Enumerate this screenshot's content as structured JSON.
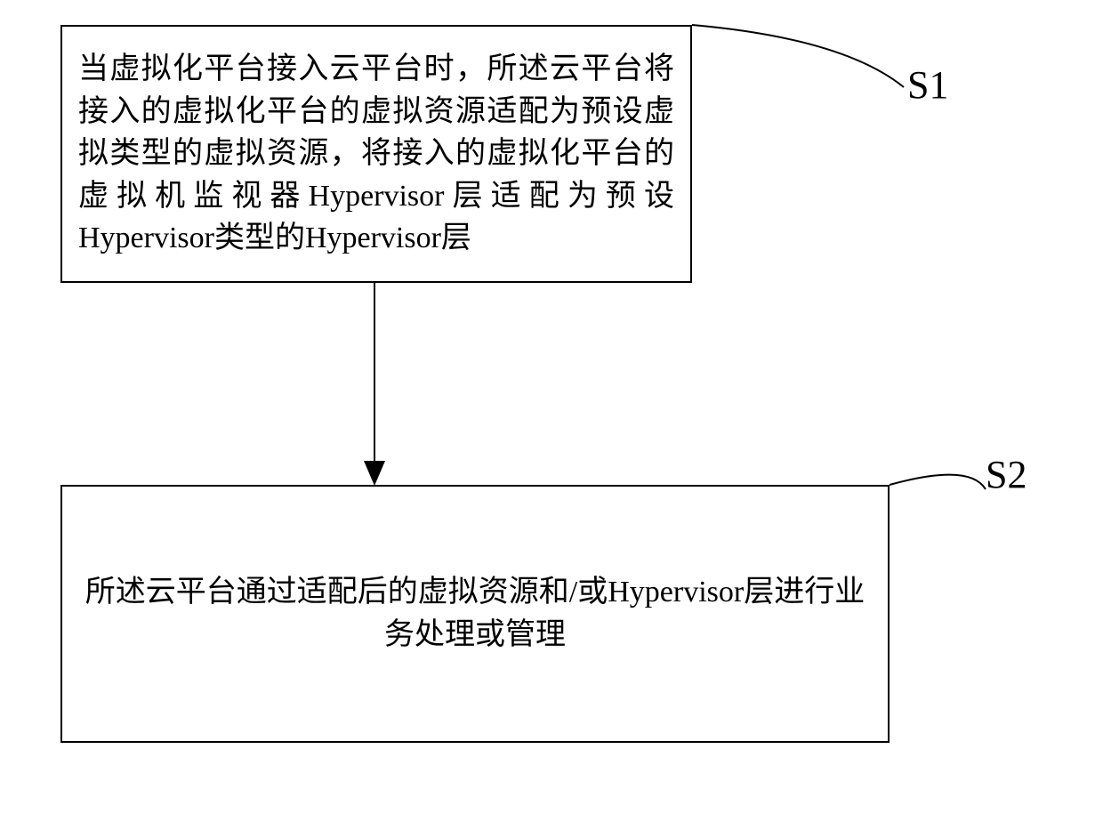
{
  "steps": {
    "s1": {
      "label": "S1",
      "text": "当虚拟化平台接入云平台时，所述云平台将接入的虚拟化平台的虚拟资源适配为预设虚拟类型的虚拟资源，将接入的虚拟化平台的虚拟机监视器Hypervisor层适配为预设Hypervisor类型的Hypervisor层"
    },
    "s2": {
      "label": "S2",
      "text": "所述云平台通过适配后的虚拟资源和/或Hypervisor层进行业务处理或管理"
    }
  }
}
